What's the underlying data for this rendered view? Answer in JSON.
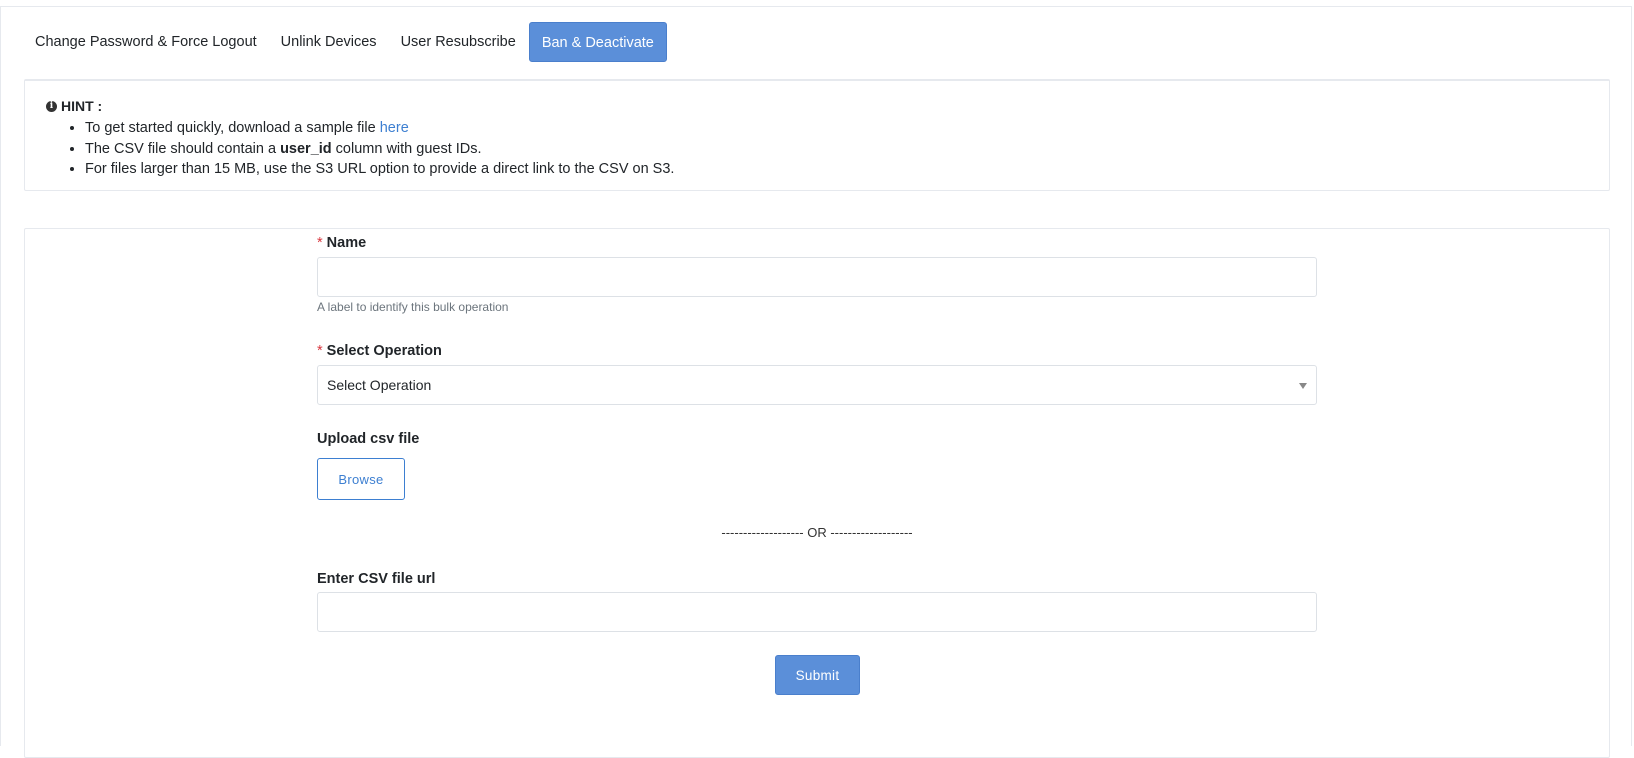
{
  "tabs": [
    {
      "label": "Change Password & Force Logout",
      "active": false
    },
    {
      "label": "Unlink Devices",
      "active": false
    },
    {
      "label": "User Resubscribe",
      "active": false
    },
    {
      "label": "Ban & Deactivate",
      "active": true
    }
  ],
  "hint": {
    "icon": "info-circle-icon",
    "title": "HINT :",
    "items": [
      {
        "text": "To get started quickly, download a sample file ",
        "link": "here"
      },
      {
        "before": "The CSV file should contain a ",
        "bold": "user_id",
        "after": " column with guest IDs."
      },
      {
        "text": "For files larger than 15 MB, use the S3 URL option to provide a direct link to the CSV on S3."
      }
    ]
  },
  "form": {
    "required_mark": "*",
    "name_label": "Name",
    "name_value": "",
    "name_helper": "A label to identify this bulk operation",
    "operation_label": "Select Operation",
    "operation_value": "Select Operation",
    "upload_label": "Upload csv file",
    "browse_label": "Browse",
    "or_text": "------------------- OR -------------------",
    "url_label": "Enter CSV file url",
    "url_value": "",
    "submit_label": "Submit"
  },
  "colors": {
    "accent": "#5b8fd9",
    "link": "#3d7fd1",
    "required": "#d9363e"
  }
}
